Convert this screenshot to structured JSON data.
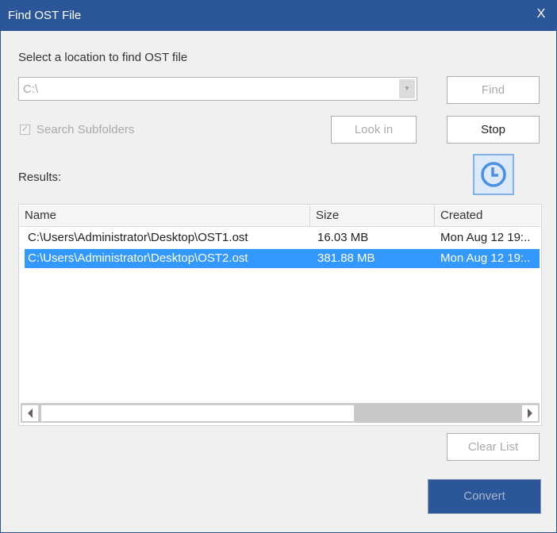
{
  "window": {
    "title": "Find OST File",
    "close_label": "X"
  },
  "location": {
    "label": "Select a location to find OST file",
    "value": "C:\\",
    "arrow_glyph": "▼"
  },
  "buttons": {
    "find": "Find",
    "stop": "Stop",
    "look_in": "Look in",
    "clear_list": "Clear List",
    "convert": "Convert"
  },
  "options": {
    "search_subfolders_label": "Search Subfolders",
    "search_subfolders_checked": true,
    "check_glyph": "✓"
  },
  "results": {
    "label": "Results:",
    "columns": [
      "Name",
      "Size",
      "Created"
    ],
    "rows": [
      {
        "name": "C:\\Users\\Administrator\\Desktop\\OST1.ost",
        "size": "16.03 MB",
        "created": "Mon Aug 12 19:..",
        "selected": false
      },
      {
        "name": "C:\\Users\\Administrator\\Desktop\\OST2.ost",
        "size": "381.88 MB",
        "created": "Mon Aug 12 19:..",
        "selected": true
      }
    ],
    "scroll_left_glyph": "◀",
    "scroll_right_glyph": "▶"
  },
  "colors": {
    "titlebar": "#2b579a",
    "selection": "#3399ff",
    "convert_button": "#2b579a",
    "clock_icon": "#4a90e2"
  }
}
